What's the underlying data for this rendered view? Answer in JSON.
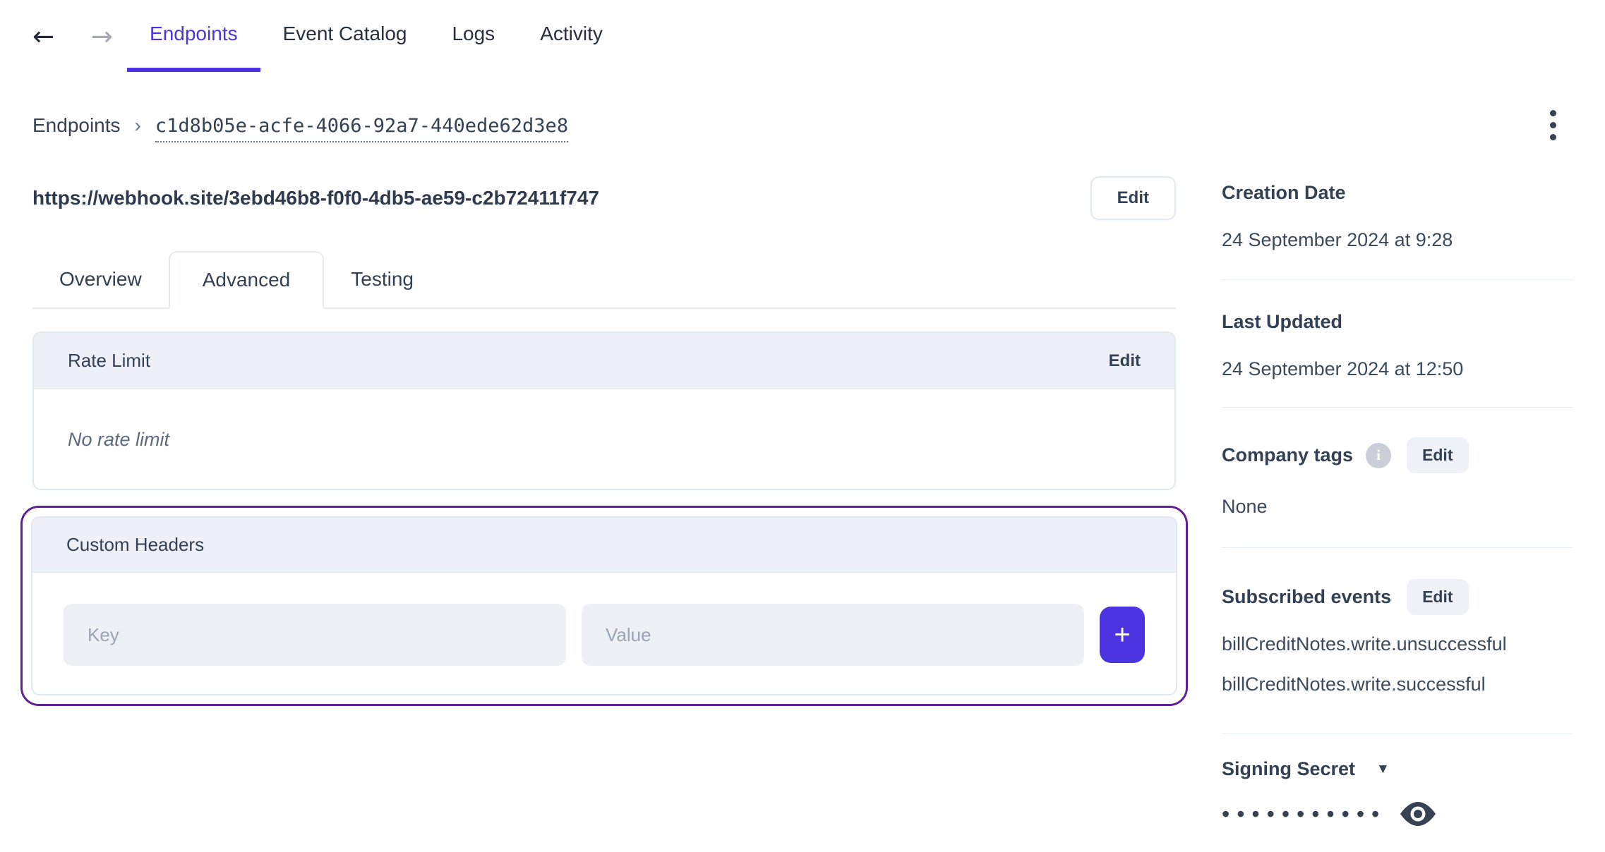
{
  "colors": {
    "accent": "#4c33e0",
    "highlight": "#5e1f97",
    "header_bg": "#edf0f6",
    "text_dark": "#334155",
    "text_muted": "#5b6b80",
    "placeholder": "#9aa6b6"
  },
  "nav": {
    "back_icon": "←",
    "forward_icon": "→",
    "tabs": [
      {
        "label": "Endpoints",
        "active": true
      },
      {
        "label": "Event Catalog",
        "active": false
      },
      {
        "label": "Logs",
        "active": false
      },
      {
        "label": "Activity",
        "active": false
      }
    ]
  },
  "breadcrumb": {
    "root": "Endpoints",
    "separator": "›",
    "current": "c1d8b05e-acfe-4066-92a7-440ede62d3e8"
  },
  "endpoint": {
    "url": "https://webhook.site/3ebd46b8-f0f0-4db5-ae59-c2b72411f747",
    "edit_label": "Edit",
    "tabs": [
      {
        "label": "Overview",
        "active": false
      },
      {
        "label": "Advanced",
        "active": true
      },
      {
        "label": "Testing",
        "active": false
      }
    ]
  },
  "rate_limit": {
    "title": "Rate Limit",
    "edit_label": "Edit",
    "empty_text": "No rate limit"
  },
  "custom_headers": {
    "title": "Custom Headers",
    "key_placeholder": "Key",
    "value_placeholder": "Value",
    "add_label": "+"
  },
  "sidebar": {
    "creation_date": {
      "label": "Creation Date",
      "value": "24 September 2024 at 9:28"
    },
    "last_updated": {
      "label": "Last Updated",
      "value": "24 September 2024 at 12:50"
    },
    "company_tags": {
      "label": "Company tags",
      "info_icon": "i",
      "edit_label": "Edit",
      "value": "None"
    },
    "subscribed_events": {
      "label": "Subscribed events",
      "edit_label": "Edit",
      "events": [
        "billCreditNotes.write.unsuccessful",
        "billCreditNotes.write.successful"
      ]
    },
    "signing_secret": {
      "label": "Signing Secret",
      "caret_icon": "▼",
      "masked_value": "•••••••••••"
    }
  }
}
